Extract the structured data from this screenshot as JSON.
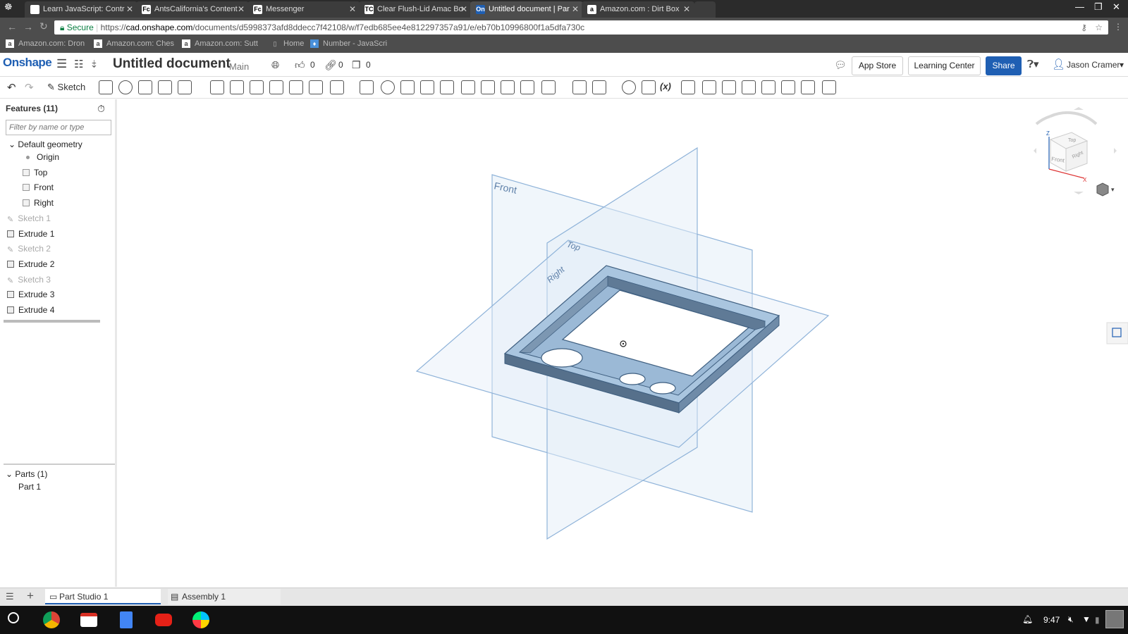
{
  "browser": {
    "tabs": [
      {
        "favicon": "",
        "title": "Learn JavaScript: Contr",
        "active": false
      },
      {
        "favicon": "Fc",
        "title": "AntsCalifornia's Content",
        "active": false
      },
      {
        "favicon": "Fc",
        "title": "Messenger",
        "active": false
      },
      {
        "favicon": "TC",
        "title": "Clear Flush-Lid Amac Bo",
        "active": false
      },
      {
        "favicon": "On",
        "title": "Untitled document | Par",
        "active": true
      },
      {
        "favicon": "a",
        "title": "Amazon.com : Dirt Box",
        "active": false
      }
    ],
    "secure_label": "Secure",
    "url_prefix": "https://",
    "url_host": "cad.onshape.com",
    "url_path": "/documents/d5998373afd8ddecc7f42108/w/f7edb685ee4e812297357a91/e/eb70b10996800f1a5dfa730c",
    "bookmarks": [
      {
        "icon": "a",
        "label": "Amazon.com: Dron"
      },
      {
        "icon": "a",
        "label": "Amazon.com: Ches"
      },
      {
        "icon": "a",
        "label": "Amazon.com: Sutt"
      },
      {
        "icon": "page",
        "label": "Home"
      },
      {
        "icon": "js",
        "label": "Number - JavaScri"
      }
    ]
  },
  "header": {
    "logo": "Onshape",
    "doc_title": "Untitled document",
    "branch": "Main",
    "likes": "0",
    "links": "0",
    "copies": "0",
    "app_store": "App Store",
    "learning_center": "Learning Center",
    "share": "Share",
    "user": "Jason Cramer"
  },
  "toolbar": {
    "sketch_label": "Sketch"
  },
  "features": {
    "title": "Features (11)",
    "filter_placeholder": "Filter by name or type",
    "group": "Default geometry",
    "items": [
      {
        "label": "Origin",
        "kind": "origin",
        "dim": false
      },
      {
        "label": "Top",
        "kind": "plane",
        "dim": false
      },
      {
        "label": "Front",
        "kind": "plane",
        "dim": false
      },
      {
        "label": "Right",
        "kind": "plane",
        "dim": false
      },
      {
        "label": "Sketch 1",
        "kind": "sketch",
        "dim": true
      },
      {
        "label": "Extrude 1",
        "kind": "extrude",
        "dim": false
      },
      {
        "label": "Sketch 2",
        "kind": "sketch",
        "dim": true
      },
      {
        "label": "Extrude 2",
        "kind": "extrude",
        "dim": false
      },
      {
        "label": "Sketch 3",
        "kind": "sketch",
        "dim": true
      },
      {
        "label": "Extrude 3",
        "kind": "extrude",
        "dim": false
      },
      {
        "label": "Extrude 4",
        "kind": "extrude",
        "dim": false
      }
    ],
    "parts_title": "Parts (1)",
    "parts": [
      "Part 1"
    ]
  },
  "viewport": {
    "plane_front": "Front",
    "plane_top": "Top",
    "plane_right": "Right",
    "cube_top": "Top",
    "cube_front": "Front",
    "cube_right": "Right",
    "axis_z": "Z",
    "axis_x": "X"
  },
  "bottom_tabs": {
    "part_studio": "Part Studio 1",
    "assembly": "Assembly 1"
  },
  "taskbar": {
    "time": "9:47"
  },
  "colors": {
    "brand": "#1f5fb3",
    "plane_fill": "#dce8f5",
    "plane_stroke": "#8fb3d9",
    "part_fill": "#9ab9d6",
    "part_dark": "#4a6a8a"
  }
}
